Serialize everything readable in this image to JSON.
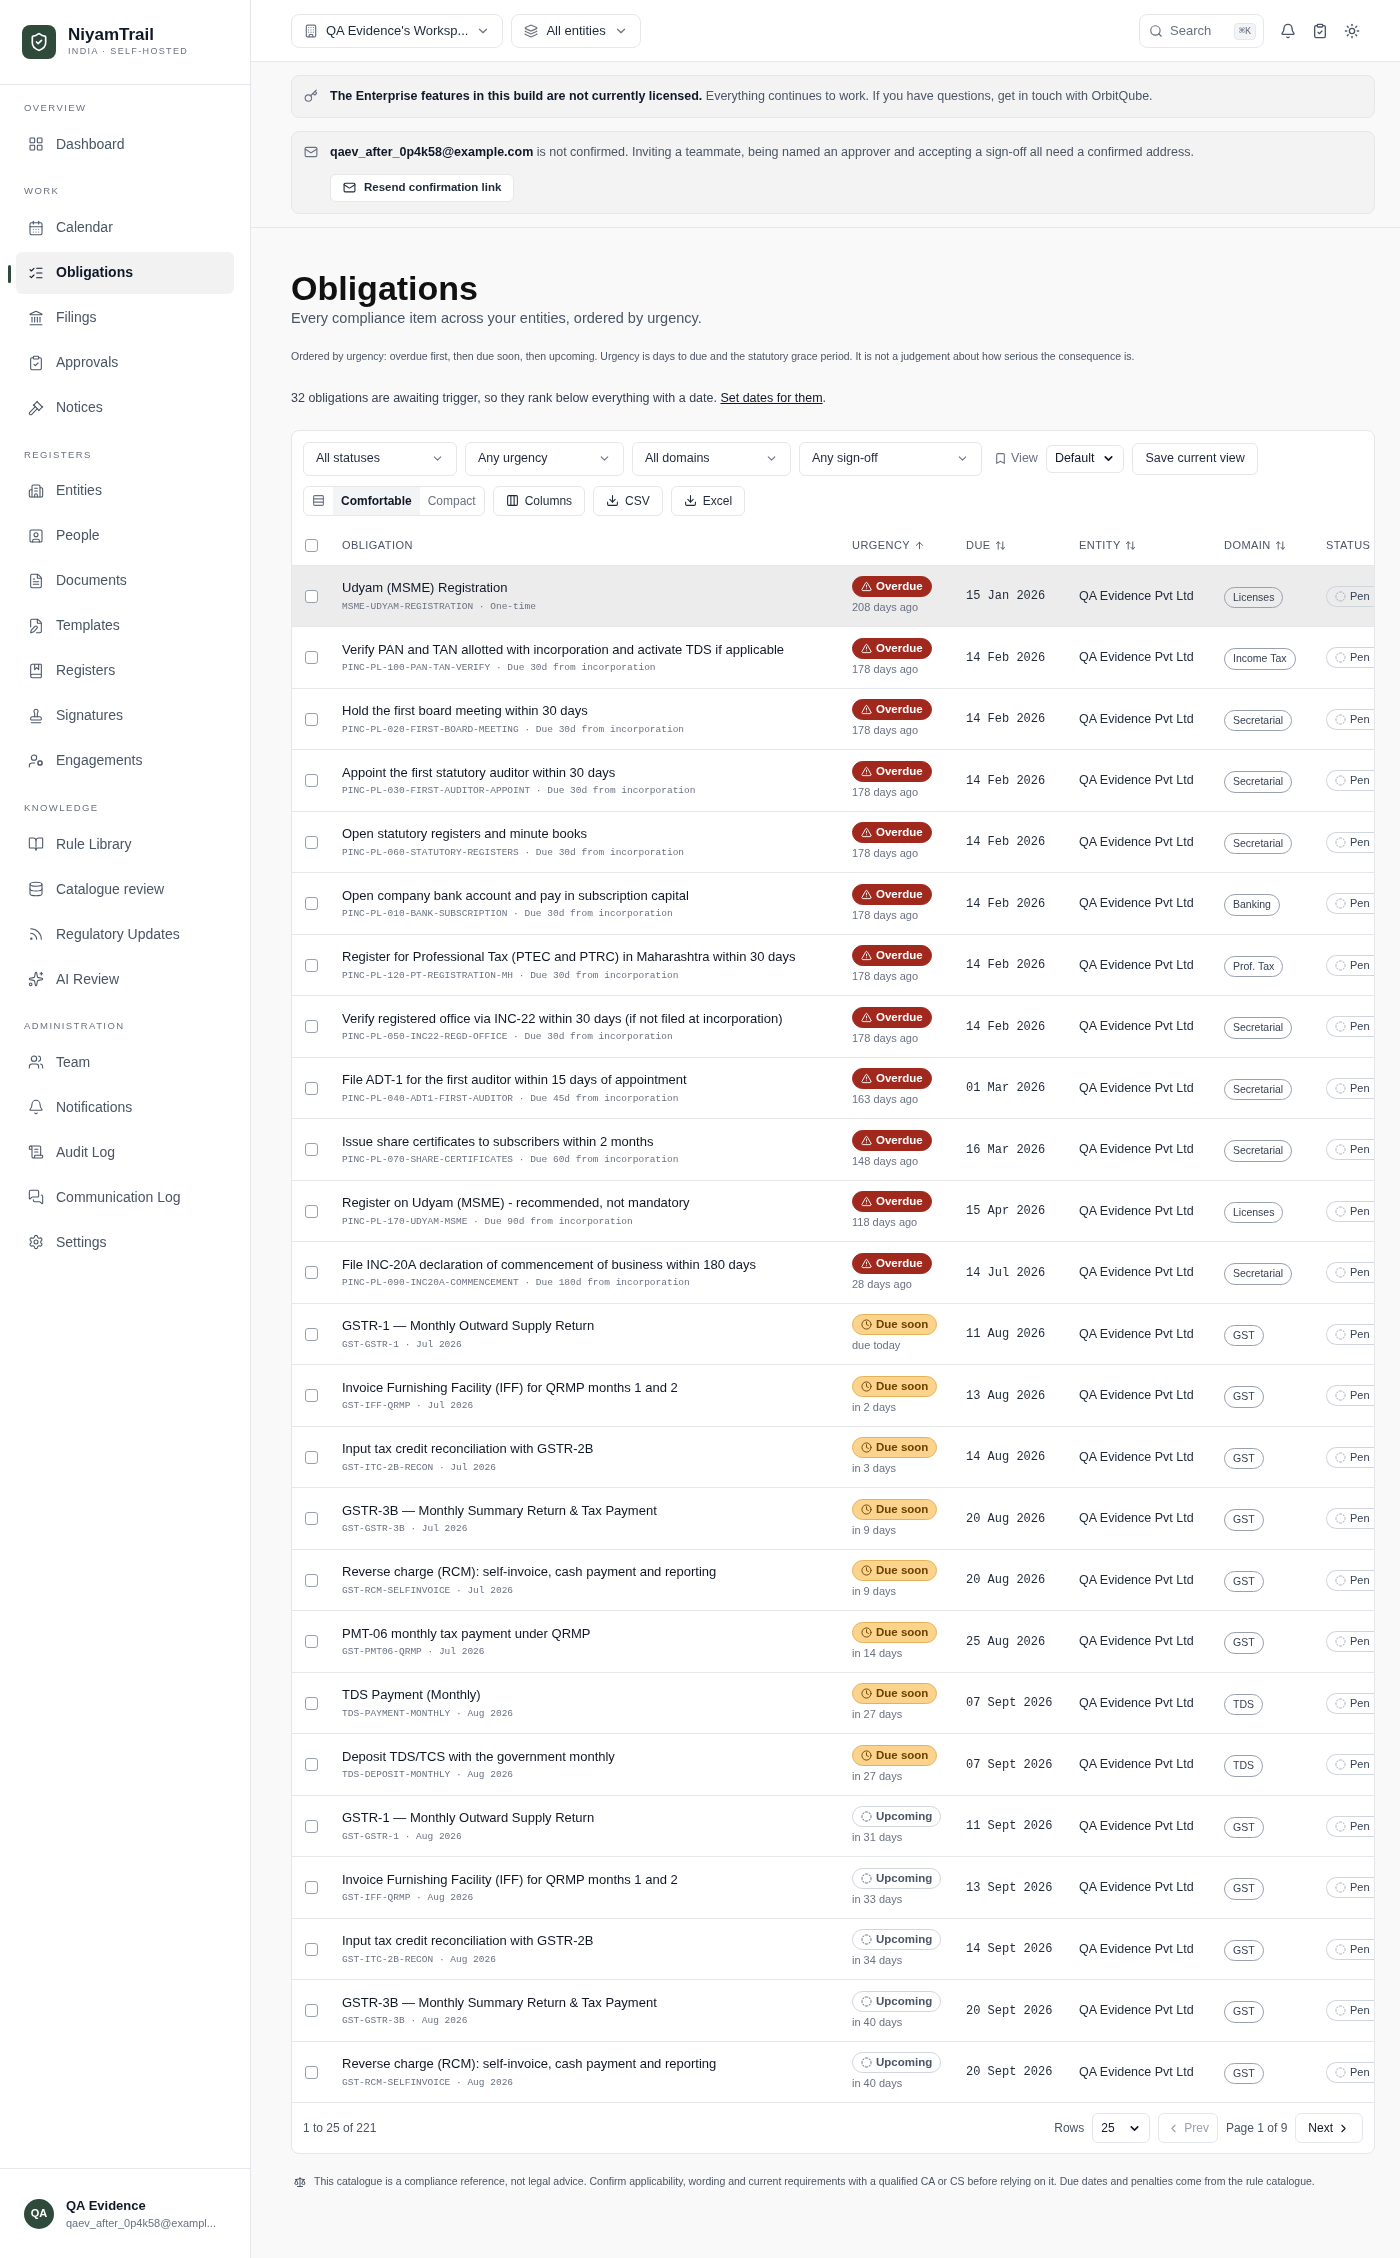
{
  "sidebar": {
    "brand": {
      "name": "NiyamTrail",
      "tagline": "INDIA · SELF-HOSTED"
    },
    "sections": [
      {
        "label": "OVERVIEW",
        "items": [
          {
            "label": "Dashboard",
            "selected": false
          }
        ]
      },
      {
        "label": "WORK",
        "items": [
          {
            "label": "Calendar",
            "selected": false
          },
          {
            "label": "Obligations",
            "selected": true
          },
          {
            "label": "Filings",
            "selected": false
          },
          {
            "label": "Approvals",
            "selected": false
          },
          {
            "label": "Notices",
            "selected": false
          }
        ]
      },
      {
        "label": "REGISTERS",
        "items": [
          {
            "label": "Entities",
            "selected": false
          },
          {
            "label": "People",
            "selected": false
          },
          {
            "label": "Documents",
            "selected": false
          },
          {
            "label": "Templates",
            "selected": false
          },
          {
            "label": "Registers",
            "selected": false
          },
          {
            "label": "Signatures",
            "selected": false
          },
          {
            "label": "Engagements",
            "selected": false
          }
        ]
      },
      {
        "label": "KNOWLEDGE",
        "items": [
          {
            "label": "Rule Library",
            "selected": false
          },
          {
            "label": "Catalogue review",
            "selected": false
          },
          {
            "label": "Regulatory Updates",
            "selected": false
          },
          {
            "label": "AI Review",
            "selected": false
          }
        ]
      },
      {
        "label": "ADMINISTRATION",
        "items": [
          {
            "label": "Team",
            "selected": false
          },
          {
            "label": "Notifications",
            "selected": false
          },
          {
            "label": "Audit Log",
            "selected": false
          },
          {
            "label": "Communication Log",
            "selected": false
          },
          {
            "label": "Settings",
            "selected": false
          }
        ]
      }
    ],
    "user": {
      "initials": "QA",
      "name": "QA Evidence",
      "email": "qaev_after_0p4k58@exampl..."
    }
  },
  "topbar": {
    "workspace": "QA Evidence's Worksp...",
    "entities": "All entities",
    "search": {
      "placeholder": "Search"
    },
    "shortcut": "⌘K"
  },
  "banners": [
    {
      "kind": "license",
      "text": "**The Enterprise features in this build are not currently licensed.** Everything continues to work. If you have questions, get in touch with OrbitQube."
    },
    {
      "kind": "email",
      "text": "**qaev_after_0p4k58@example.com** is not confirmed. Inviting a teammate, being named an approver and accepting a sign-off all need a confirmed address.",
      "button": "Resend confirmation link"
    }
  ],
  "page": {
    "title": "Obligations",
    "subtitle": "Every compliance item across your entities, ordered by urgency.",
    "note": "Ordered by urgency: overdue first, then due soon, then upcoming. Urgency is days to due and the statutory grace period. It is not a judgement about how serious the consequence is.",
    "trigger_note": {
      "text": "32 obligations are awaiting trigger, so they rank below everything with a date.",
      "link": "Set dates for them",
      "suffix": "."
    }
  },
  "filters": [
    "All statuses",
    "Any urgency",
    "All domains",
    "Any sign-off"
  ],
  "view": {
    "label": "View",
    "value": "Default",
    "save": "Save current view"
  },
  "density": [
    {
      "label": "Comfortable",
      "selected": true
    },
    {
      "label": "Compact",
      "selected": false
    }
  ],
  "actions": [
    {
      "kind": "columns",
      "label": "Columns"
    },
    {
      "kind": "download",
      "label": "CSV"
    },
    {
      "kind": "download",
      "label": "Excel"
    }
  ],
  "table": {
    "select_all": {
      "checked": false
    },
    "columns": [
      {
        "label": "OBLIGATION",
        "sortable": false
      },
      {
        "label": "URGENCY",
        "sortable": true,
        "sorted": true
      },
      {
        "label": "DUE",
        "sortable": true,
        "sorted": false
      },
      {
        "label": "ENTITY",
        "sortable": true,
        "sorted": false
      },
      {
        "label": "DOMAIN",
        "sortable": true,
        "sorted": false
      },
      {
        "label": "STATUS",
        "sortable": false
      }
    ],
    "rows": [
      {
        "title": "Udyam (MSME) Registration",
        "ref": "MSME-UDYAM-REGISTRATION · One-time",
        "urgency": {
          "kind": "overdue",
          "label": "Overdue",
          "note": "208 days ago"
        },
        "due": "15 Jan 2026",
        "entity": "QA Evidence Pvt Ltd",
        "domain": "Licenses",
        "status": "Pen",
        "selected": false,
        "highlighted": true
      },
      {
        "title": "Verify PAN and TAN allotted with incorporation and activate TDS if applicable",
        "ref": "PINC-PL-100-PAN-TAN-VERIFY · Due 30d from incorporation",
        "urgency": {
          "kind": "overdue",
          "label": "Overdue",
          "note": "178 days ago"
        },
        "due": "14 Feb 2026",
        "entity": "QA Evidence Pvt Ltd",
        "domain": "Income Tax",
        "status": "Pen",
        "selected": false,
        "highlighted": false
      },
      {
        "title": "Hold the first board meeting within 30 days",
        "ref": "PINC-PL-020-FIRST-BOARD-MEETING · Due 30d from incorporation",
        "urgency": {
          "kind": "overdue",
          "label": "Overdue",
          "note": "178 days ago"
        },
        "due": "14 Feb 2026",
        "entity": "QA Evidence Pvt Ltd",
        "domain": "Secretarial",
        "status": "Pen",
        "selected": false,
        "highlighted": false
      },
      {
        "title": "Appoint the first statutory auditor within 30 days",
        "ref": "PINC-PL-030-FIRST-AUDITOR-APPOINT · Due 30d from incorporation",
        "urgency": {
          "kind": "overdue",
          "label": "Overdue",
          "note": "178 days ago"
        },
        "due": "14 Feb 2026",
        "entity": "QA Evidence Pvt Ltd",
        "domain": "Secretarial",
        "status": "Pen",
        "selected": false,
        "highlighted": false
      },
      {
        "title": "Open statutory registers and minute books",
        "ref": "PINC-PL-060-STATUTORY-REGISTERS · Due 30d from incorporation",
        "urgency": {
          "kind": "overdue",
          "label": "Overdue",
          "note": "178 days ago"
        },
        "due": "14 Feb 2026",
        "entity": "QA Evidence Pvt Ltd",
        "domain": "Secretarial",
        "status": "Pen",
        "selected": false,
        "highlighted": false
      },
      {
        "title": "Open company bank account and pay in subscription capital",
        "ref": "PINC-PL-010-BANK-SUBSCRIPTION · Due 30d from incorporation",
        "urgency": {
          "kind": "overdue",
          "label": "Overdue",
          "note": "178 days ago"
        },
        "due": "14 Feb 2026",
        "entity": "QA Evidence Pvt Ltd",
        "domain": "Banking",
        "status": "Pen",
        "selected": false,
        "highlighted": false
      },
      {
        "title": "Register for Professional Tax (PTEC and PTRC) in Maharashtra within 30 days",
        "ref": "PINC-PL-120-PT-REGISTRATION-MH · Due 30d from incorporation",
        "urgency": {
          "kind": "overdue",
          "label": "Overdue",
          "note": "178 days ago"
        },
        "due": "14 Feb 2026",
        "entity": "QA Evidence Pvt Ltd",
        "domain": "Prof. Tax",
        "status": "Pen",
        "selected": false,
        "highlighted": false
      },
      {
        "title": "Verify registered office via INC-22 within 30 days (if not filed at incorporation)",
        "ref": "PINC-PL-050-INC22-REGD-OFFICE · Due 30d from incorporation",
        "urgency": {
          "kind": "overdue",
          "label": "Overdue",
          "note": "178 days ago"
        },
        "due": "14 Feb 2026",
        "entity": "QA Evidence Pvt Ltd",
        "domain": "Secretarial",
        "status": "Pen",
        "selected": false,
        "highlighted": false
      },
      {
        "title": "File ADT-1 for the first auditor within 15 days of appointment",
        "ref": "PINC-PL-040-ADT1-FIRST-AUDITOR · Due 45d from incorporation",
        "urgency": {
          "kind": "overdue",
          "label": "Overdue",
          "note": "163 days ago"
        },
        "due": "01 Mar 2026",
        "entity": "QA Evidence Pvt Ltd",
        "domain": "Secretarial",
        "status": "Pen",
        "selected": false,
        "highlighted": false
      },
      {
        "title": "Issue share certificates to subscribers within 2 months",
        "ref": "PINC-PL-070-SHARE-CERTIFICATES · Due 60d from incorporation",
        "urgency": {
          "kind": "overdue",
          "label": "Overdue",
          "note": "148 days ago"
        },
        "due": "16 Mar 2026",
        "entity": "QA Evidence Pvt Ltd",
        "domain": "Secretarial",
        "status": "Pen",
        "selected": false,
        "highlighted": false
      },
      {
        "title": "Register on Udyam (MSME) - recommended, not mandatory",
        "ref": "PINC-PL-170-UDYAM-MSME · Due 90d from incorporation",
        "urgency": {
          "kind": "overdue",
          "label": "Overdue",
          "note": "118 days ago"
        },
        "due": "15 Apr 2026",
        "entity": "QA Evidence Pvt Ltd",
        "domain": "Licenses",
        "status": "Pen",
        "selected": false,
        "highlighted": false
      },
      {
        "title": "File INC-20A declaration of commencement of business within 180 days",
        "ref": "PINC-PL-090-INC20A-COMMENCEMENT · Due 180d from incorporation",
        "urgency": {
          "kind": "overdue",
          "label": "Overdue",
          "note": "28 days ago"
        },
        "due": "14 Jul 2026",
        "entity": "QA Evidence Pvt Ltd",
        "domain": "Secretarial",
        "status": "Pen",
        "selected": false,
        "highlighted": false
      },
      {
        "title": "GSTR-1 — Monthly Outward Supply Return",
        "ref": "GST-GSTR-1 · Jul 2026",
        "urgency": {
          "kind": "due_soon",
          "label": "Due soon",
          "note": "due today"
        },
        "due": "11 Aug 2026",
        "entity": "QA Evidence Pvt Ltd",
        "domain": "GST",
        "status": "Pen",
        "selected": false,
        "highlighted": false
      },
      {
        "title": "Invoice Furnishing Facility (IFF) for QRMP months 1 and 2",
        "ref": "GST-IFF-QRMP · Jul 2026",
        "urgency": {
          "kind": "due_soon",
          "label": "Due soon",
          "note": "in 2 days"
        },
        "due": "13 Aug 2026",
        "entity": "QA Evidence Pvt Ltd",
        "domain": "GST",
        "status": "Pen",
        "selected": false,
        "highlighted": false
      },
      {
        "title": "Input tax credit reconciliation with GSTR-2B",
        "ref": "GST-ITC-2B-RECON · Jul 2026",
        "urgency": {
          "kind": "due_soon",
          "label": "Due soon",
          "note": "in 3 days"
        },
        "due": "14 Aug 2026",
        "entity": "QA Evidence Pvt Ltd",
        "domain": "GST",
        "status": "Pen",
        "selected": false,
        "highlighted": false
      },
      {
        "title": "GSTR-3B — Monthly Summary Return & Tax Payment",
        "ref": "GST-GSTR-3B · Jul 2026",
        "urgency": {
          "kind": "due_soon",
          "label": "Due soon",
          "note": "in 9 days"
        },
        "due": "20 Aug 2026",
        "entity": "QA Evidence Pvt Ltd",
        "domain": "GST",
        "status": "Pen",
        "selected": false,
        "highlighted": false
      },
      {
        "title": "Reverse charge (RCM): self-invoice, cash payment and reporting",
        "ref": "GST-RCM-SELFINVOICE · Jul 2026",
        "urgency": {
          "kind": "due_soon",
          "label": "Due soon",
          "note": "in 9 days"
        },
        "due": "20 Aug 2026",
        "entity": "QA Evidence Pvt Ltd",
        "domain": "GST",
        "status": "Pen",
        "selected": false,
        "highlighted": false
      },
      {
        "title": "PMT-06 monthly tax payment under QRMP",
        "ref": "GST-PMT06-QRMP · Jul 2026",
        "urgency": {
          "kind": "due_soon",
          "label": "Due soon",
          "note": "in 14 days"
        },
        "due": "25 Aug 2026",
        "entity": "QA Evidence Pvt Ltd",
        "domain": "GST",
        "status": "Pen",
        "selected": false,
        "highlighted": false
      },
      {
        "title": "TDS Payment (Monthly)",
        "ref": "TDS-PAYMENT-MONTHLY · Aug 2026",
        "urgency": {
          "kind": "due_soon",
          "label": "Due soon",
          "note": "in 27 days"
        },
        "due": "07 Sept 2026",
        "entity": "QA Evidence Pvt Ltd",
        "domain": "TDS",
        "status": "Pen",
        "selected": false,
        "highlighted": false
      },
      {
        "title": "Deposit TDS/TCS with the government monthly",
        "ref": "TDS-DEPOSIT-MONTHLY · Aug 2026",
        "urgency": {
          "kind": "due_soon",
          "label": "Due soon",
          "note": "in 27 days"
        },
        "due": "07 Sept 2026",
        "entity": "QA Evidence Pvt Ltd",
        "domain": "TDS",
        "status": "Pen",
        "selected": false,
        "highlighted": false
      },
      {
        "title": "GSTR-1 — Monthly Outward Supply Return",
        "ref": "GST-GSTR-1 · Aug 2026",
        "urgency": {
          "kind": "upcoming",
          "label": "Upcoming",
          "note": "in 31 days"
        },
        "due": "11 Sept 2026",
        "entity": "QA Evidence Pvt Ltd",
        "domain": "GST",
        "status": "Pen",
        "selected": false,
        "highlighted": false
      },
      {
        "title": "Invoice Furnishing Facility (IFF) for QRMP months 1 and 2",
        "ref": "GST-IFF-QRMP · Aug 2026",
        "urgency": {
          "kind": "upcoming",
          "label": "Upcoming",
          "note": "in 33 days"
        },
        "due": "13 Sept 2026",
        "entity": "QA Evidence Pvt Ltd",
        "domain": "GST",
        "status": "Pen",
        "selected": false,
        "highlighted": false
      },
      {
        "title": "Input tax credit reconciliation with GSTR-2B",
        "ref": "GST-ITC-2B-RECON · Aug 2026",
        "urgency": {
          "kind": "upcoming",
          "label": "Upcoming",
          "note": "in 34 days"
        },
        "due": "14 Sept 2026",
        "entity": "QA Evidence Pvt Ltd",
        "domain": "GST",
        "status": "Pen",
        "selected": false,
        "highlighted": false
      },
      {
        "title": "GSTR-3B — Monthly Summary Return & Tax Payment",
        "ref": "GST-GSTR-3B · Aug 2026",
        "urgency": {
          "kind": "upcoming",
          "label": "Upcoming",
          "note": "in 40 days"
        },
        "due": "20 Sept 2026",
        "entity": "QA Evidence Pvt Ltd",
        "domain": "GST",
        "status": "Pen",
        "selected": false,
        "highlighted": false
      },
      {
        "title": "Reverse charge (RCM): self-invoice, cash payment and reporting",
        "ref": "GST-RCM-SELFINVOICE · Aug 2026",
        "urgency": {
          "kind": "upcoming",
          "label": "Upcoming",
          "note": "in 40 days"
        },
        "due": "20 Sept 2026",
        "entity": "QA Evidence Pvt Ltd",
        "domain": "GST",
        "status": "Pen",
        "selected": false,
        "highlighted": false
      }
    ]
  },
  "pagination": {
    "range": "1 to 25 of 221",
    "rows_label": "Rows",
    "rows_value": "25",
    "prev": {
      "label": "Prev",
      "disabled": true
    },
    "page": "Page 1 of 9",
    "next": {
      "label": "Next",
      "disabled": false
    }
  },
  "footer_note": "This catalogue is a compliance reference, not legal advice. Confirm applicability, wording and current requirements with a qualified CA or CS before relying on it. Due dates and penalties come from the rule catalogue."
}
